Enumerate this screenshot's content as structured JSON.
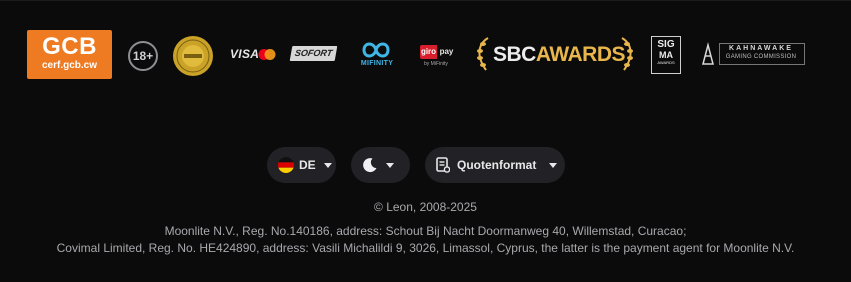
{
  "logos": {
    "gcb": {
      "title": "GCB",
      "subtitle": "cerf.gcb.cw",
      "color": "#ee7a22"
    },
    "age": "18+",
    "visa": "VISA",
    "sofort": "SOFORT",
    "mifinity": "MIFINITY",
    "giropay": {
      "giro": "giro",
      "pay": "pay",
      "sub": "by MiFinity"
    },
    "sbc": {
      "sbc": "SBC",
      "awards": "AWARDS"
    },
    "sigma": {
      "line1": "SIG",
      "line2": "MA",
      "line3": "AWARDS"
    },
    "kahnawake": {
      "name": "KAHNAWAKE",
      "sub": "GAMING COMMISSION"
    }
  },
  "controls": {
    "language": {
      "value": "DE",
      "icon": "germany-flag-icon"
    },
    "theme": {
      "icon": "moon-icon"
    },
    "odds_format": {
      "label": "Quotenformat",
      "icon": "document-icon"
    }
  },
  "footer": {
    "copyright": "© Leon, 2008-2025",
    "legal_line_1": "Moonlite N.V., Reg. No.140186, address: Schout Bij Nacht Doormanweg 40, Willemstad, Curacao;",
    "legal_line_2": "Covimal Limited, Reg. No. HE424890, address: Vasili Michalildi 9, 3026, Limassol, Cyprus, the latter is the payment agent for Moonlite N.V."
  },
  "colors": {
    "background": "#0b0b0c",
    "pill": "#222226",
    "gcb_orange": "#ee7a22",
    "sbc_gold": "#e8b64a"
  }
}
